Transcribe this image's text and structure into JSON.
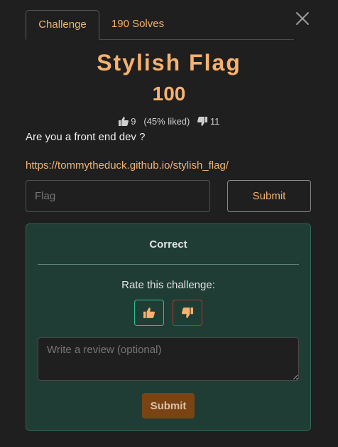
{
  "tabs": [
    {
      "label": "Challenge"
    },
    {
      "label": "190 Solves"
    }
  ],
  "challenge": {
    "title": "Stylish Flag",
    "points": "100",
    "likes": "9",
    "liked_percent": "(45% liked)",
    "dislikes": "11",
    "description": "Are you a front end dev ?",
    "link": "https://tommytheduck.github.io/stylish_flag/"
  },
  "flag_form": {
    "placeholder": "Flag",
    "submit_label": "Submit"
  },
  "result": {
    "status": "Correct",
    "rate_label": "Rate this challenge:",
    "review_placeholder": "Write a review (optional)",
    "submit_label": "Submit"
  },
  "icons": {
    "close": "close-icon",
    "like": "thumbs-up-icon",
    "dislike": "thumbs-down-icon"
  },
  "colors": {
    "accent": "#f6b26e",
    "panel_bg": "#1f3d35",
    "panel_border": "#2f6a58",
    "like_green": "#2ec08e",
    "dislike_red": "#b13a2f",
    "review_button": "#7a4314"
  }
}
